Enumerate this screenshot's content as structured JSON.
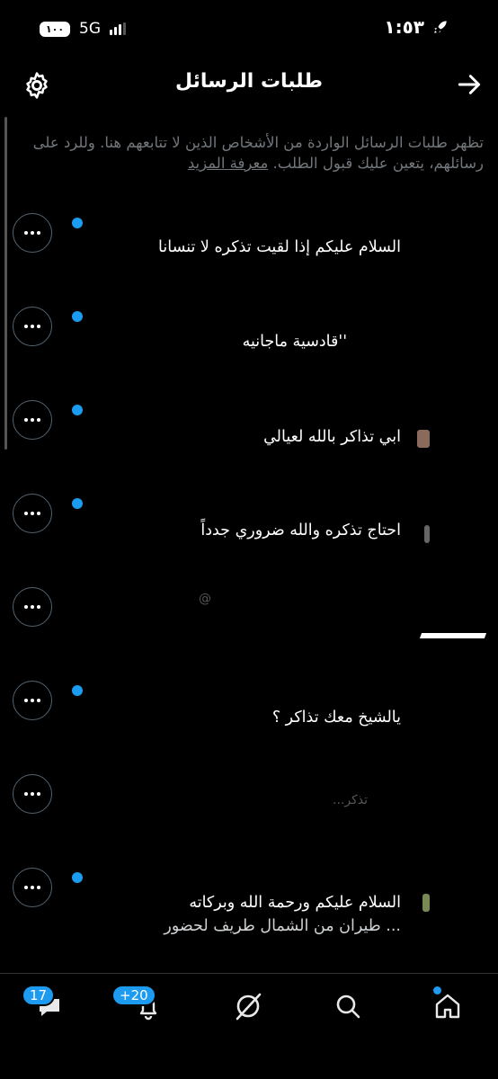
{
  "status_bar": {
    "time": "١:٥٣",
    "network": "5G",
    "battery": "١٠٠"
  },
  "header": {
    "title": "طلبات الرسائل"
  },
  "intro": {
    "text": "تظهر طلبات الرسائل الواردة من الأشخاص الذين لا تتابعهم هنا. وللرد على رسائلهم، يتعين عليك قبول الطلب.",
    "learn_more": "معرفة المزيد"
  },
  "requests": [
    {
      "message": "السلام عليكم إذا لقيت تذكره لا تنسانا",
      "unread": true
    },
    {
      "message": "''قادسية ماجانيه",
      "unread": true
    },
    {
      "message": "ابي تذاكر بالله لعيالي",
      "unread": true
    },
    {
      "message": "احتاج تذكره والله ضروري جدداً",
      "unread": true
    },
    {
      "message": "@",
      "unread": false
    },
    {
      "message": "يالشيخ معك تذاكر ؟",
      "unread": true
    },
    {
      "message": "تذكر...",
      "unread": false
    },
    {
      "message": "السلام عليكم ورحمة الله وبركاته",
      "message_line2": "... طيران من الشمال طريف لحضور",
      "unread": true
    }
  ],
  "tabs": {
    "messages_badge": "17",
    "notifications_badge": "+20"
  },
  "colors": {
    "accent": "#1d9bf0",
    "background": "#000000"
  }
}
